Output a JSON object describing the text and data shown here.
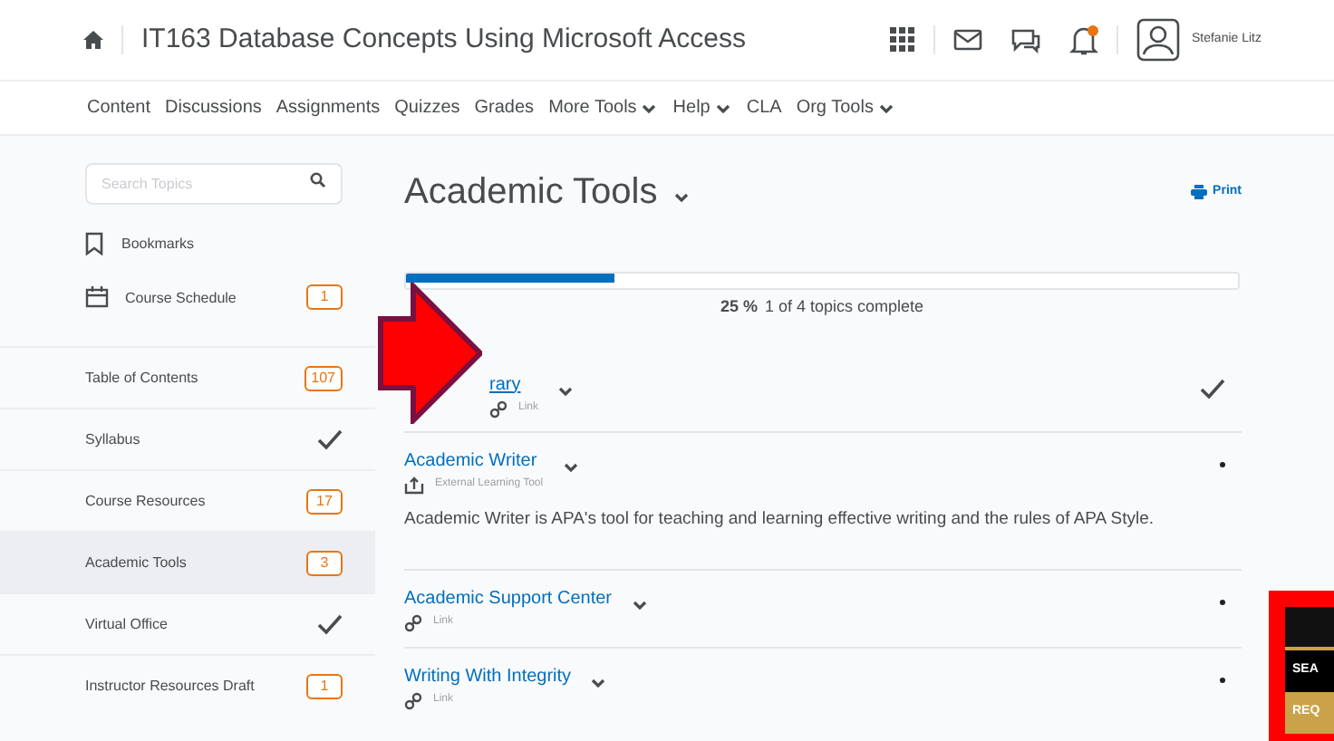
{
  "header": {
    "course_title": "IT163 Database Concepts Using Microsoft Access",
    "notification_unread": true,
    "user_name": "Stefanie Litz"
  },
  "nav": [
    {
      "label": "Content",
      "has_menu": false
    },
    {
      "label": "Discussions",
      "has_menu": false
    },
    {
      "label": "Assignments",
      "has_menu": false
    },
    {
      "label": "Quizzes",
      "has_menu": false
    },
    {
      "label": "Grades",
      "has_menu": false
    },
    {
      "label": "More Tools",
      "has_menu": true
    },
    {
      "label": "Help",
      "has_menu": true
    },
    {
      "label": "CLA",
      "has_menu": false
    },
    {
      "label": "Org Tools",
      "has_menu": true
    }
  ],
  "sidebar": {
    "search": {
      "placeholder": "Search Topics"
    },
    "items": [
      {
        "kind": "bookmarks",
        "label": "Bookmarks",
        "selected": false
      },
      {
        "kind": "schedule",
        "label": "Course Schedule",
        "badge": "1",
        "selected": false
      },
      {
        "kind": "module",
        "label": "Table of Contents",
        "badge": "107",
        "selected": false
      },
      {
        "kind": "module",
        "label": "Syllabus",
        "done": true,
        "selected": false
      },
      {
        "kind": "module",
        "label": "Course Resources",
        "badge": "17",
        "selected": false
      },
      {
        "kind": "module",
        "label": "Academic Tools",
        "badge": "3",
        "selected": true
      },
      {
        "kind": "module",
        "label": "Virtual Office",
        "done": true,
        "selected": false
      },
      {
        "kind": "module",
        "label": "Instructor Resources Draft",
        "badge": "1",
        "selected": false
      }
    ]
  },
  "main": {
    "title": "Academic Tools",
    "print": "Print",
    "progress": {
      "level": 0.25,
      "percent": "25 %",
      "text": "1 of 4 topics complete"
    },
    "topics": [
      {
        "title": "rary",
        "kind": "link",
        "type_label": "Link",
        "done": true
      },
      {
        "title": "Academic Writer",
        "kind": "tool",
        "type_label": "External Learning Tool",
        "description": "Academic Writer is APA's tool for teaching and learning effective writing and the rules of APA Style.",
        "done": false
      },
      {
        "title": "Academic Support Center",
        "kind": "link",
        "type_label": "Link",
        "done": false
      },
      {
        "title": "Writing With Integrity",
        "kind": "link",
        "type_label": "Link",
        "done": false
      }
    ]
  },
  "side_widget": {
    "rows": [
      "SEA",
      "REQ"
    ]
  }
}
